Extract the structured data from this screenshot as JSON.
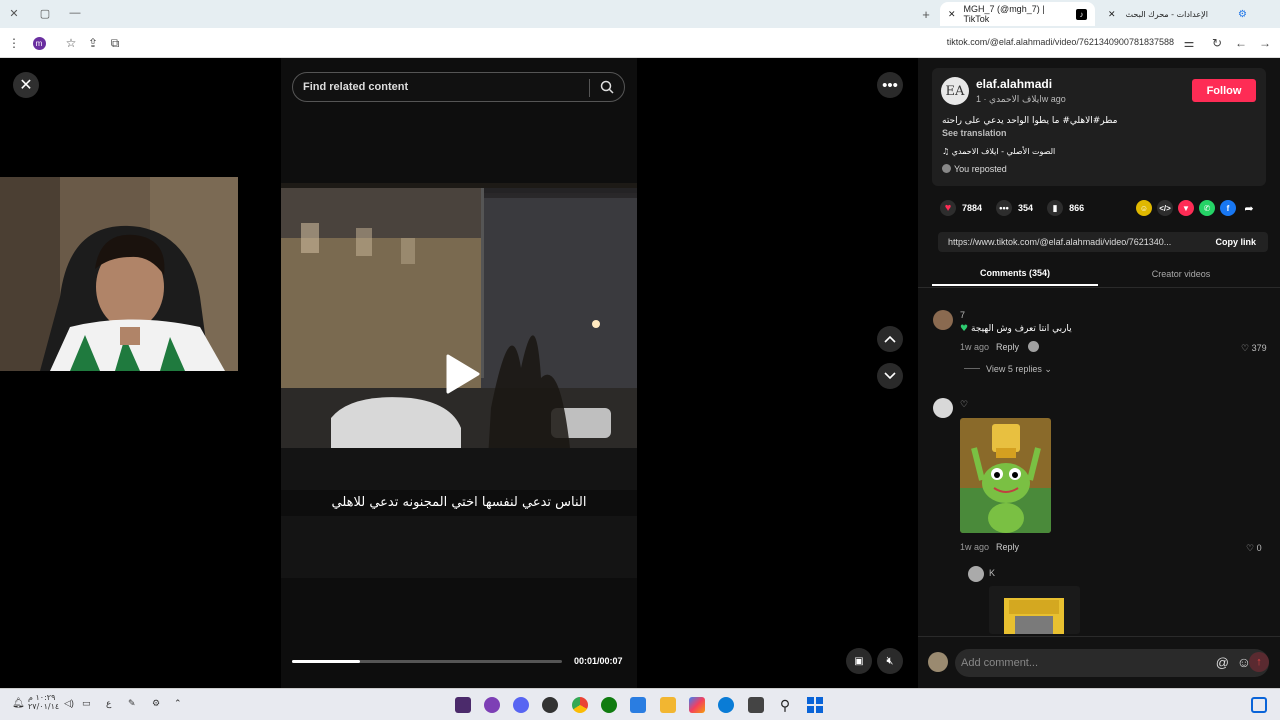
{
  "browser": {
    "tabs": [
      {
        "label": "MGH_7 (@mgh_7) | TikTok",
        "active": true
      },
      {
        "label": "الإعدادات - محرك البحث",
        "active": false
      }
    ],
    "url": "tiktok.com/@elaf.alahmadi/video/7621340900781837588"
  },
  "video": {
    "search_placeholder": "Find related content",
    "caption": "الناس تدعي لنفسها اختي المجنونه تدعي للاهلي",
    "timecode": "00:01/00:07",
    "progress_fraction": 0.25
  },
  "post": {
    "avatar_initials": "EA",
    "username": "elaf.alahmadi",
    "display_name": "ايلاف الاحمدي",
    "time": "· 1w ago",
    "follow_label": "Follow",
    "description": "مطر#الاهلي# ما يطوا الواحد يدعي على راحته",
    "see_translation": "See translation",
    "music": "♫  الصوت الأصلي - ايلاف الاحمدي",
    "reposted": "You reposted"
  },
  "stats": {
    "likes": "7884",
    "comments": "354",
    "saves": "866"
  },
  "share": {
    "link": "https://www.tiktok.com/@elaf.alahmadi/video/7621340...",
    "copy_label": "Copy link"
  },
  "tabs": {
    "comments": "Comments (354)",
    "creator": "Creator videos"
  },
  "comments": [
    {
      "author": "7",
      "text": "ياربي انتا تعرف وش الهيجة",
      "time": "1w ago",
      "reply": "Reply",
      "likes": "379",
      "view_replies": "View 5 replies"
    },
    {
      "author": "♡",
      "text": "",
      "time": "1w ago",
      "reply": "Reply",
      "likes": "0"
    },
    {
      "author": "K",
      "text": "",
      "time": "",
      "reply": "",
      "likes": ""
    }
  ],
  "comment_input": {
    "placeholder": "Add comment..."
  },
  "taskbar": {
    "clock_time": "١٠:٢٩ م",
    "clock_date": "٢٧/٠١/١٤"
  },
  "colors": {
    "follow": "#fe2c55",
    "panel_bg": "#121212",
    "like_heart": "#fe2c55"
  }
}
